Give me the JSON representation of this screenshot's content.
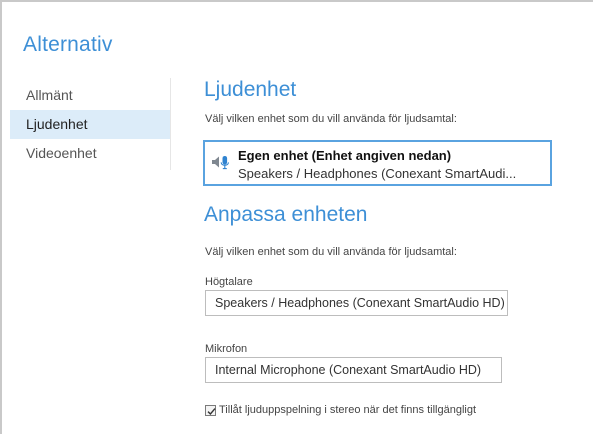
{
  "window": {
    "title": "Alternativ"
  },
  "sidebar": {
    "items": [
      {
        "label": "Allmänt",
        "selected": false
      },
      {
        "label": "Ljudenhet",
        "selected": true
      },
      {
        "label": "Videoenhet",
        "selected": false
      }
    ]
  },
  "audio_device": {
    "title": "Ljudenhet",
    "hint": "Välj vilken enhet som du vill använda för ljudsamtal:",
    "selected_device": {
      "name": "Egen enhet (Enhet angiven nedan)",
      "detail": "Speakers / Headphones (Conexant SmartAudi...",
      "icon": "speaker-microphone-icon"
    }
  },
  "customize": {
    "title": "Anpassa enheten",
    "hint": "Välj vilken enhet som du vill använda för ljudsamtal:",
    "speaker": {
      "label": "Högtalare",
      "value": "Speakers / Headphones (Conexant SmartAudio HD)"
    },
    "microphone": {
      "label": "Mikrofon",
      "value": "Internal Microphone (Conexant SmartAudio HD)"
    },
    "stereo_checkbox": {
      "label": "Tillåt ljuduppspelning i stereo när det finns tillgängligt",
      "checked": true
    }
  },
  "colors": {
    "accent": "#3d8fd6",
    "selection_background": "#dcecf9",
    "card_border": "#5aa3e0"
  }
}
